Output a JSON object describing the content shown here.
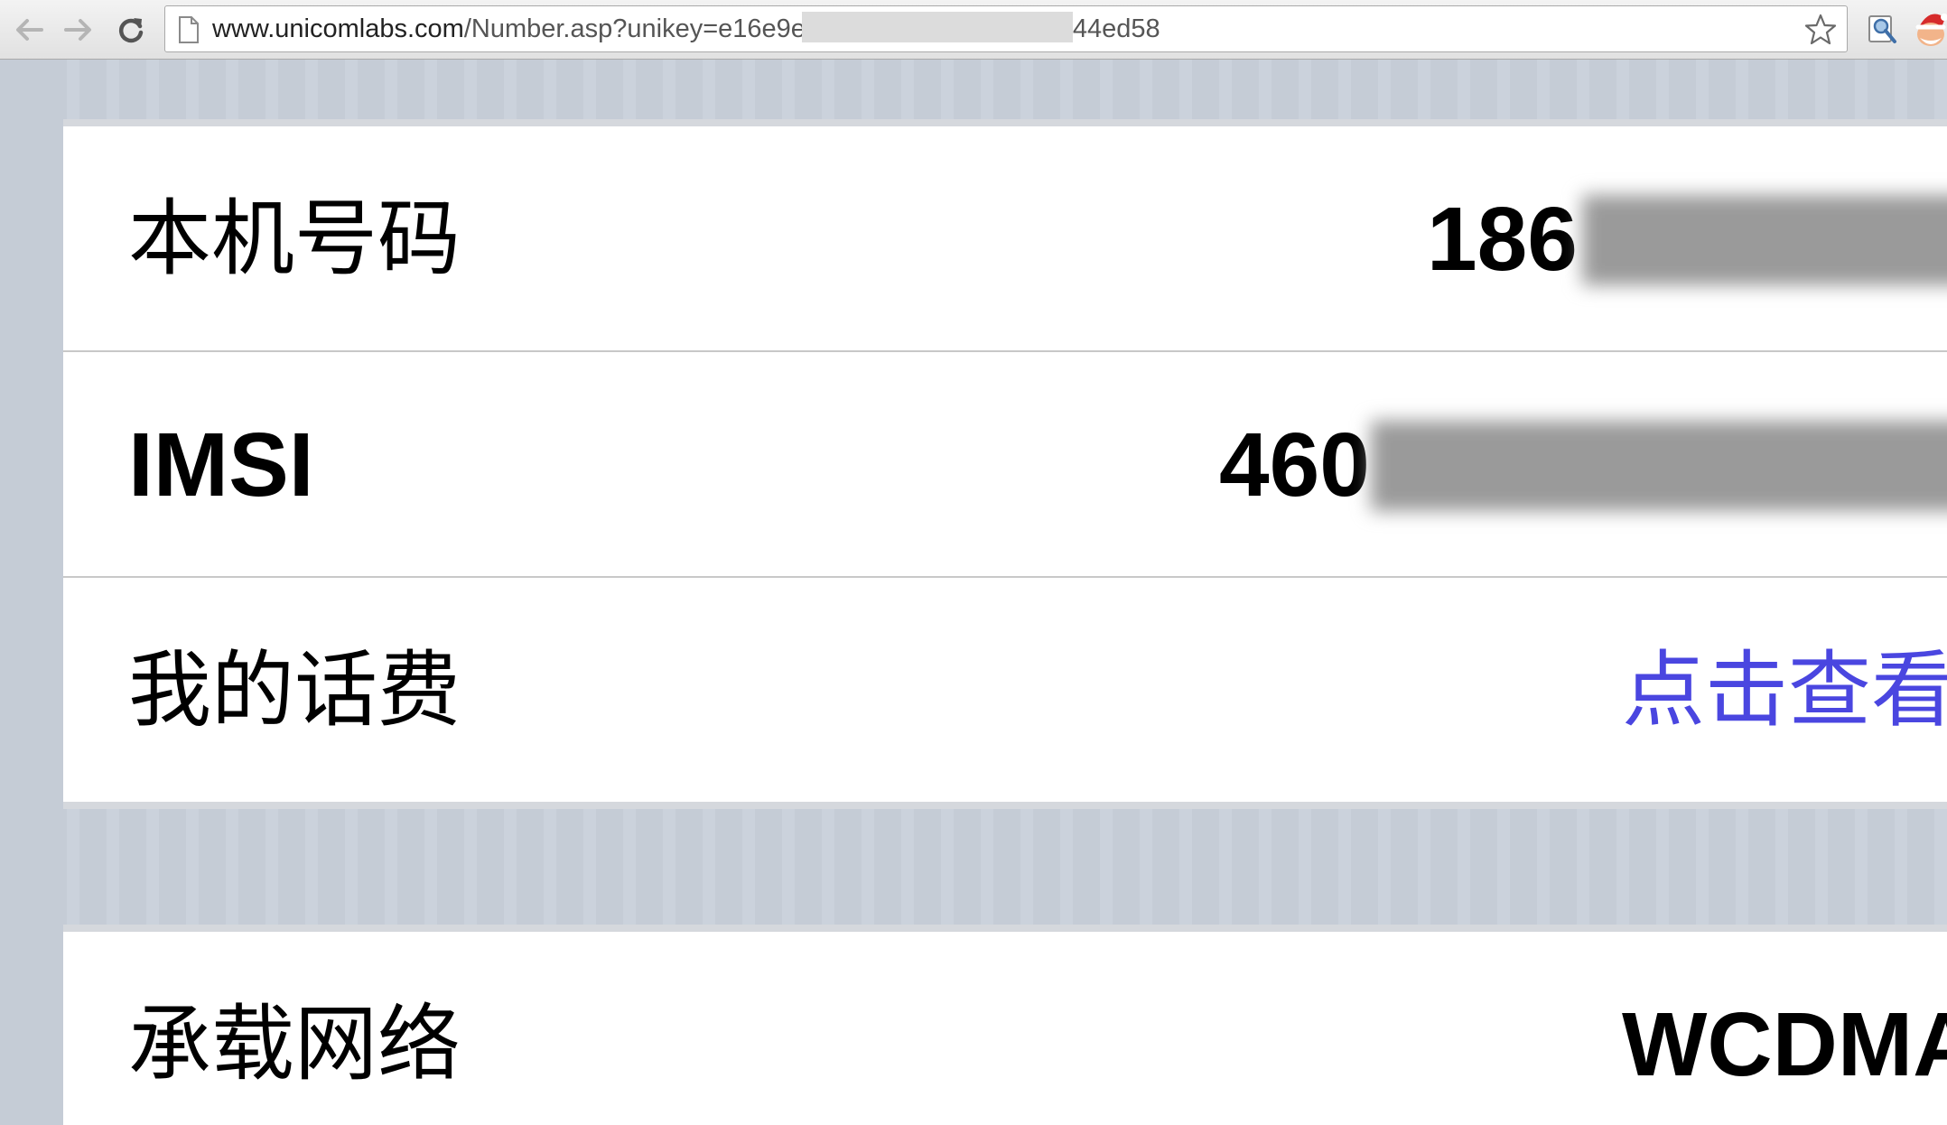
{
  "browser": {
    "url_host": "www.unicomlabs.com",
    "url_path_start": "/Number.asp?unikey=e16e9e",
    "url_path_end": "44ed58",
    "back_icon": "arrow-left-icon",
    "forward_icon": "arrow-right-icon",
    "reload_icon": "reload-icon",
    "bookmark_icon": "star-icon"
  },
  "group1": {
    "rows": [
      {
        "label": "本机号码",
        "value": "186"
      },
      {
        "label": "IMSI",
        "value": "460"
      },
      {
        "label": "我的话费",
        "value": "点击查看"
      }
    ]
  },
  "group2": {
    "rows": [
      {
        "label": "承载网络",
        "value": "WCDMA"
      }
    ]
  },
  "colors": {
    "link": "#4a46e0",
    "background": "#c5ccd6"
  }
}
